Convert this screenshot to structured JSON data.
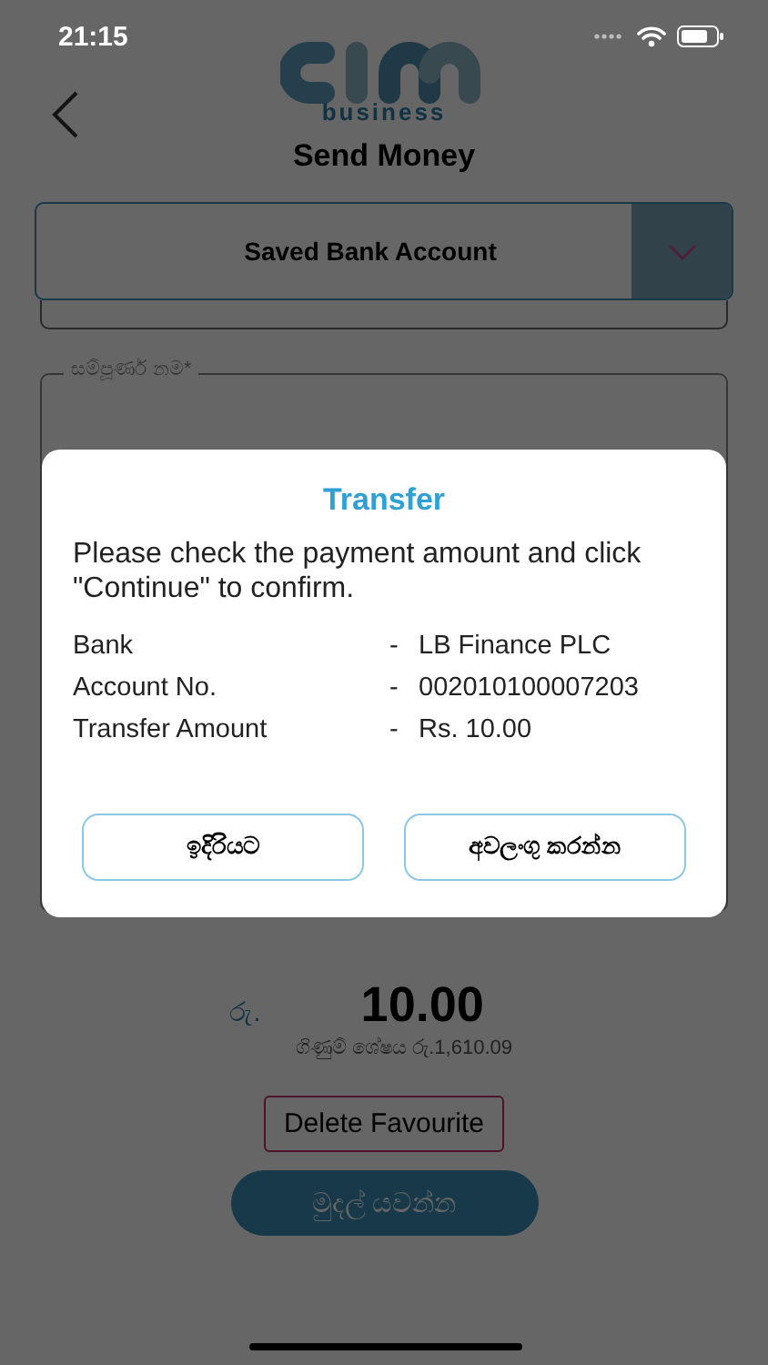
{
  "status_bar": {
    "time": "21:15"
  },
  "header": {
    "logo_text": "business",
    "title": "Send Money"
  },
  "account_type": {
    "value": "Saved Bank Account"
  },
  "full_name_field": {
    "label": "සම්පූර්ණ නම*"
  },
  "amount": {
    "currency": "රු.",
    "value": "10.00",
    "balance": "ගිණුම් ශේෂය රු.1,610.09"
  },
  "buttons": [
    {
      "kind": "outline",
      "label": "Delete Favourite"
    },
    {
      "kind": "filled",
      "label": "මුදල් යවන්න"
    }
  ],
  "dialog": {
    "title": "Transfer",
    "message": "Please check the payment amount and click \"Continue\" to confirm.",
    "details": [
      {
        "label": "Bank",
        "separator": "-",
        "value": "LB Finance PLC"
      },
      {
        "label": "Account No.",
        "separator": "-",
        "value": "002010100007203"
      },
      {
        "label": "Transfer Amount",
        "separator": "-",
        "value": "Rs.  10.00"
      }
    ],
    "buttons": [
      {
        "label": "ඉදිරියට"
      },
      {
        "label": "අවලංගු කරන්න"
      }
    ]
  }
}
